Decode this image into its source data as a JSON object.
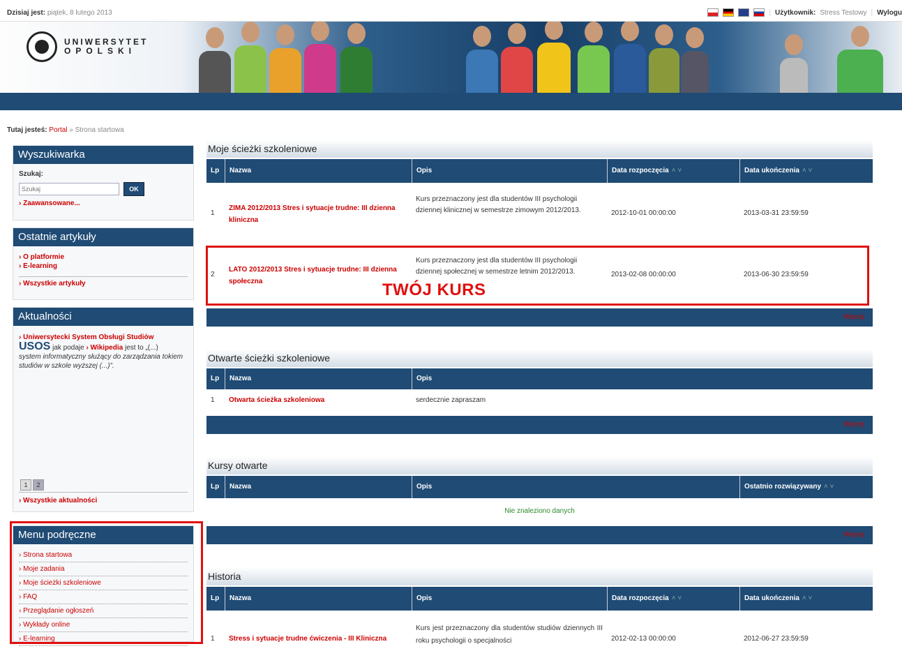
{
  "topbar": {
    "date_label": "Dzisiaj jest:",
    "date_value": "piątek, 8 lutego 2013",
    "user_label": "Użytkownik:",
    "user_value": "Stress Testowy",
    "logout": "Wylogu"
  },
  "logo": {
    "line1": "UNIWERSYTET",
    "line2": "OPOLSKI"
  },
  "breadcrumb": {
    "label": "Tutaj jesteś:",
    "portal": "Portal",
    "sep": "»",
    "current": "Strona startowa"
  },
  "search": {
    "title": "Wyszukiwarka",
    "label": "Szukaj:",
    "placeholder": "Szukaj",
    "button": "OK",
    "advanced": "Zaawansowane..."
  },
  "articles": {
    "title": "Ostatnie artykuły",
    "items": [
      "O platformie",
      "E-learning"
    ],
    "all": "Wszystkie artykuły"
  },
  "news": {
    "title": "Aktualności",
    "link1": "Uniwersytecki System Obsługi Studiów",
    "usos": "USOS",
    "text1": "jak podaje",
    "link2": "Wikipedia",
    "text2": "jest to „(...)",
    "quote": "system informatyczny służący do zarządzania tokiem studiów w szkole wyższej (...)”.",
    "pages": [
      "1",
      "2"
    ],
    "all": "Wszystkie aktualności"
  },
  "quickmenu": {
    "title": "Menu podręczne",
    "items": [
      "Strona startowa",
      "Moje zadania",
      "Moje ścieżki szkoleniowe",
      "FAQ",
      "Przeglądanie ogłoszeń",
      "Wykłady online",
      "E-learning"
    ]
  },
  "my_paths": {
    "title": "Moje ścieżki szkoleniowe",
    "headers": {
      "lp": "Lp",
      "name": "Nazwa",
      "desc": "Opis",
      "start": "Data rozpoczęcia",
      "end": "Data ukończenia"
    },
    "rows": [
      {
        "lp": "1",
        "name": "ZIMA 2012/2013 Stres i sytuacje trudne: III dzienna kliniczna",
        "desc": "Kurs przeznaczony jest dla studentów III psychologii dziennej klinicznej w semestrze zimowym 2012/2013.",
        "start": "2012-10-01 00:00:00",
        "end": "2013-03-31 23:59:59"
      },
      {
        "lp": "2",
        "name": "LATO 2012/2013 Stres i sytuacje trudne: III dzienna społeczna",
        "desc": "Kurs przeznaczony jest dla studentów III psychologii dziennej społecznej w semestrze letnim 2012/2013.",
        "start": "2013-02-08 00:00:00",
        "end": "2013-06-30 23:59:59"
      }
    ],
    "more": "Więcej",
    "annotation": "TWÓJ KURS"
  },
  "open_paths": {
    "title": "Otwarte ścieżki szkoleniowe",
    "headers": {
      "lp": "Lp",
      "name": "Nazwa",
      "desc": "Opis"
    },
    "rows": [
      {
        "lp": "1",
        "name": "Otwarta ścieżka szkoleniowa",
        "desc": "serdecznie zapraszam"
      }
    ],
    "more": "Więcej"
  },
  "open_courses": {
    "title": "Kursy otwarte",
    "headers": {
      "lp": "Lp",
      "name": "Nazwa",
      "desc": "Opis",
      "last": "Ostatnio rozwiązywany"
    },
    "empty": "Nie znaleziono danych",
    "more": "Więcej"
  },
  "history": {
    "title": "Historia",
    "headers": {
      "lp": "Lp",
      "name": "Nazwa",
      "desc": "Opis",
      "start": "Data rozpoczęcia",
      "end": "Data ukończenia"
    },
    "rows": [
      {
        "lp": "1",
        "name": "Stress i sytuacje trudne ćwiczenia - III Kliniczna",
        "desc": "Kurs jest przeznaczony dla studentów studiów dziennych III roku psychologii o specjalności",
        "start": "2012-02-13 00:00:00",
        "end": "2012-06-27 23:59:59"
      }
    ]
  },
  "colors": {
    "nav": "#1f4b74",
    "accent_red": "#cc0000",
    "highlight_box": "#e01010"
  },
  "sort_icon": "sort-arrows-icon"
}
